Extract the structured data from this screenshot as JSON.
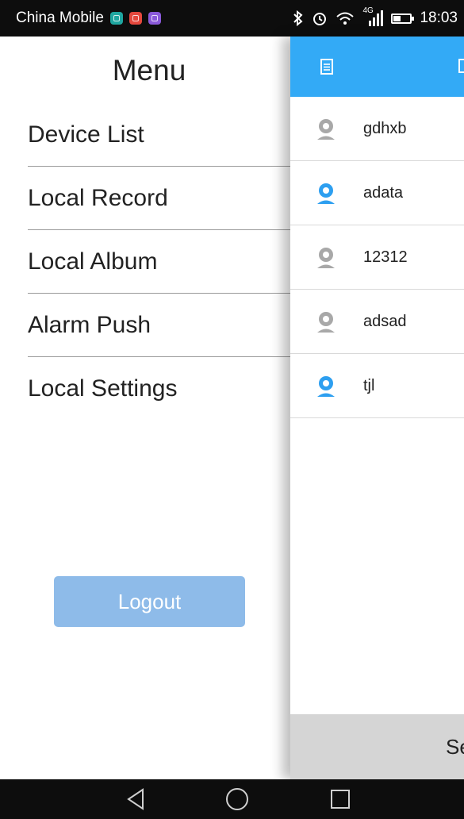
{
  "status_bar": {
    "carrier": "China Mobile",
    "network": "4G",
    "time": "18:03",
    "icons": [
      "teal-app-icon",
      "red-mail-icon",
      "purple-gallery-icon",
      "bluetooth-icon",
      "alarm-icon",
      "wifi-icon",
      "signal-icon",
      "battery-icon"
    ]
  },
  "drawer": {
    "title": "Menu",
    "items": [
      {
        "label": "Device List"
      },
      {
        "label": "Local Record"
      },
      {
        "label": "Local Album"
      },
      {
        "label": "Alarm Push"
      },
      {
        "label": "Local Settings"
      }
    ],
    "logout_label": "Logout"
  },
  "content": {
    "header_icons": [
      "list-icon",
      "page-icon"
    ],
    "devices": [
      {
        "name": "gdhxb",
        "online": false
      },
      {
        "name": "adata",
        "online": true
      },
      {
        "name": "12312",
        "online": false
      },
      {
        "name": "adsad",
        "online": false
      },
      {
        "name": "tjl",
        "online": true
      }
    ],
    "bottom_label": "Se"
  },
  "colors": {
    "accent": "#33aaf6",
    "logout": "#8ebbe9",
    "online": "#2d9ff0",
    "offline": "#a8a8a8"
  },
  "nav_bar": {
    "buttons": [
      "back-icon",
      "home-icon",
      "recents-icon"
    ]
  }
}
